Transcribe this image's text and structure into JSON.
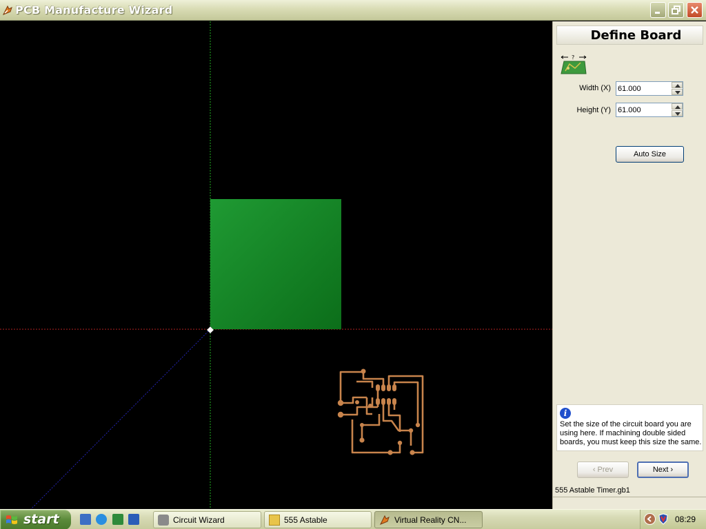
{
  "window": {
    "title": "PCB Manufacture Wizard",
    "controls": {
      "minimize": "minimize",
      "maximize": "maximize",
      "close": "close"
    }
  },
  "panel": {
    "title": "Define Board",
    "width_label": "Width (X)",
    "width_value": "61.000",
    "height_label": "Height (Y)",
    "height_value": "61.000",
    "auto_size_label": "Auto Size",
    "info_text": "Set the size of the circuit board you are using here. If machining double sided boards, you must keep this size the same.",
    "prev_label": "‹ Prev",
    "next_label": "Next ›",
    "filename": "555 Astable Timer.gb1"
  },
  "colors": {
    "board": "#1a8a2a",
    "trace": "#c8844c",
    "grid_vertical": "#2ecc2e",
    "grid_horizontal": "#cc2e2e",
    "grid_diagonal": "#2e2ecc"
  },
  "taskbar": {
    "start_label": "start",
    "quick_launch": [
      "ie-icon",
      "ie-icon",
      "excel-icon",
      "word-icon"
    ],
    "tasks": [
      {
        "label": "Circuit Wizard",
        "icon": "circuit-wizard-icon",
        "active": false
      },
      {
        "label": "555 Astable",
        "icon": "folder-icon",
        "active": false
      },
      {
        "label": "Virtual Reality CN...",
        "icon": "vr-cnc-icon",
        "active": true
      }
    ],
    "clock": "08:29"
  }
}
